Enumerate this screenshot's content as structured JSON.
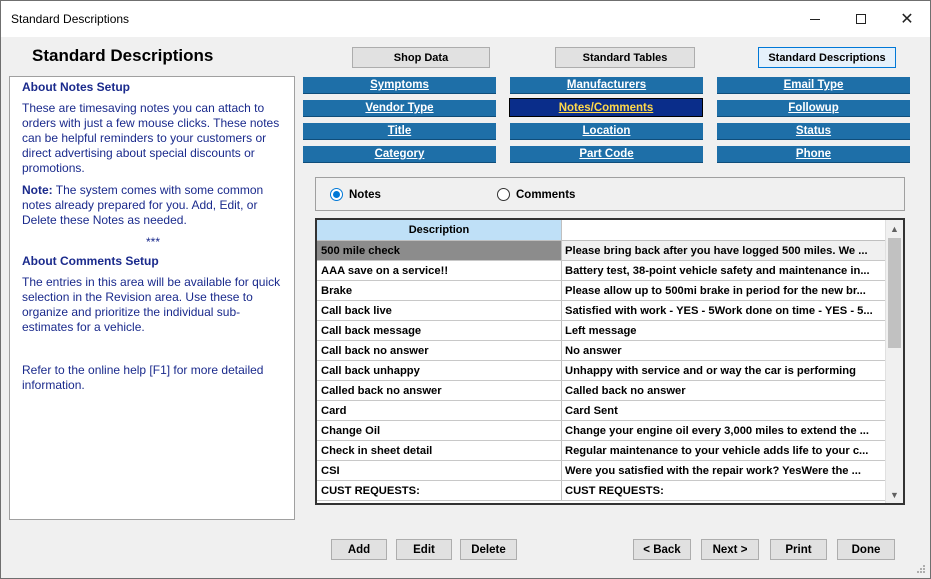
{
  "window": {
    "title": "Standard Descriptions"
  },
  "heading": "Standard Descriptions",
  "top_buttons": [
    "Shop Data",
    "Standard Tables",
    "Standard Descriptions"
  ],
  "info": {
    "notes_heading": "About Notes Setup",
    "notes_text": "These are timesaving notes you can attach to orders with just a few mouse clicks. These notes can be helpful reminders to your customers or direct advertising about special discounts or promotions.",
    "note_label": "Note:",
    "note_text": " The system comes with some common notes already prepared for you. Add, Edit, or Delete these Notes as needed.",
    "separator": "***",
    "comments_heading": "About Comments Setup",
    "comments_text": "The entries in this area will be available for quick selection in the Revision area. Use these to organize and prioritize the individual sub-estimates for a vehicle.",
    "help_text": "Refer to the online help [F1] for more detailed information."
  },
  "nav": {
    "col1": [
      "Symptoms",
      "Vendor Type",
      "Title",
      "Category"
    ],
    "col2": [
      "Manufacturers",
      "Notes/Comments",
      "Location",
      "Part Code"
    ],
    "col3": [
      "Email Type",
      "Followup",
      "Status",
      "Phone"
    ],
    "active": "Notes/Comments"
  },
  "radio": {
    "notes": "Notes",
    "comments": "Comments",
    "selected": "Notes"
  },
  "grid": {
    "header": "Description",
    "rows": [
      [
        "500 mile check",
        "Please bring back after you have logged 500 miles.  We ..."
      ],
      [
        "AAA save on a service!!",
        "Battery test, 38-point vehicle safety and maintenance in..."
      ],
      [
        "Brake",
        "Please allow up to 500mi brake in period for the new br..."
      ],
      [
        "Call back live",
        "Satisfied with work - YES - 5Work done on time - YES - 5..."
      ],
      [
        "Call back message",
        "Left message"
      ],
      [
        "Call back no answer",
        "No answer"
      ],
      [
        "Call back unhappy",
        "Unhappy with service and or way the car is performing"
      ],
      [
        "Called back no answer",
        "Called back no answer"
      ],
      [
        "Card",
        "Card Sent"
      ],
      [
        "Change Oil",
        "Change your engine oil every 3,000 miles to extend the ..."
      ],
      [
        "Check in sheet detail",
        "Regular maintenance to your vehicle adds life to your c..."
      ],
      [
        "CSI",
        "Were you satisfied with the repair work?  YesWere the ..."
      ],
      [
        "CUST REQUESTS:",
        "CUST REQUESTS:"
      ]
    ]
  },
  "bottom_buttons": {
    "add": "Add",
    "edit": "Edit",
    "delete": "Delete",
    "back": "< Back",
    "next": "Next >",
    "print": "Print",
    "done": "Done"
  },
  "icons": {
    "scroll_up": "▲",
    "scroll_down": "▼",
    "close": "✕"
  }
}
